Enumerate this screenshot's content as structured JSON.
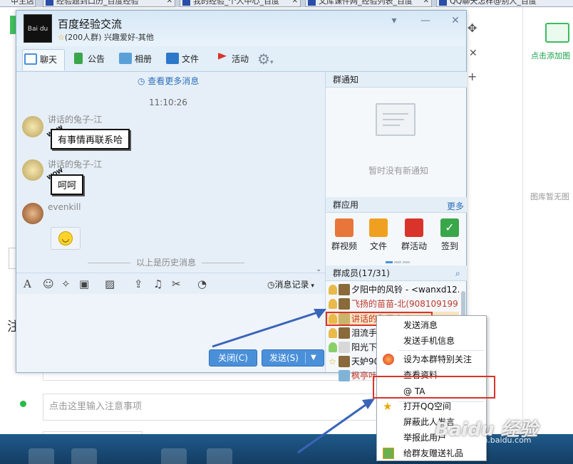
{
  "browser_tabs": [
    {
      "label": "甲主店"
    },
    {
      "label": "经验题到口历_百度经验"
    },
    {
      "label": "我的经验_个人中心_百度"
    },
    {
      "label": "文库课件网_经验列表_百度"
    },
    {
      "label": "QQ聊天怎样@别人_百度"
    }
  ],
  "background": {
    "photo_add": "点击添加图",
    "no_image": "图库暂无图",
    "note_placeholder": "点击这里输入注意事项",
    "zhu": "注"
  },
  "qq": {
    "group_logo": "Bai du 百度",
    "group_name": "百度经验交流",
    "group_meta": "(200人群) 兴趣爱好-其他",
    "window_controls": [
      "▾",
      "—",
      "✕"
    ],
    "tabs": [
      {
        "label": "聊天",
        "color": "#4a90d9"
      },
      {
        "label": "公告",
        "color": "#3aa64a"
      },
      {
        "label": "相册",
        "color": "#5aa0d8"
      },
      {
        "label": "文件",
        "color": "#2d78c8"
      },
      {
        "label": "活动",
        "color": "#d8342c"
      }
    ],
    "chat": {
      "more_messages": "查看更多消息",
      "time": "11:10:26",
      "messages": [
        {
          "sender": "讲话的兔子-江",
          "text": "有事情再联系哈"
        },
        {
          "sender": "讲话的兔子-江",
          "text": "呵呵"
        },
        {
          "sender": "evenkill",
          "text": ""
        }
      ],
      "history_divider": "以上是历史消息",
      "wow": "WOW"
    },
    "input": {
      "msg_record": "消息记录",
      "close_button": "关闭(C)",
      "send_button": "发送(S)"
    },
    "panel": {
      "notice_title": "群通知",
      "no_notice": "暂时没有新通知",
      "apps_title": "群应用",
      "apps_more": "更多",
      "apps": [
        {
          "label": "群视频",
          "color": "#e8763a"
        },
        {
          "label": "文件",
          "color": "#f0a020"
        },
        {
          "label": "群活动",
          "color": "#d8342c"
        },
        {
          "label": "签到",
          "color": "#3aa64a"
        }
      ],
      "members_title": "群成员(17/31)",
      "members": [
        {
          "name": "夕阳中的风铃 - <wanxd12...",
          "color": "#111"
        },
        {
          "name": "飞扬的苗苗-北(908109199)",
          "color": "#c0392b"
        },
        {
          "name": "讲话的兔子-江(131257???004)",
          "color": "#c0392b"
        },
        {
          "name": "泪流手",
          "color": "#111"
        },
        {
          "name": "阳光下",
          "color": "#111"
        },
        {
          "name": "天妒90",
          "color": "#111"
        },
        {
          "name": "枫亭叶",
          "color": "#c0392b"
        }
      ]
    }
  },
  "context_menu": {
    "items": [
      {
        "label": "发送消息",
        "icon": ""
      },
      {
        "label": "发送手机信息",
        "icon": ""
      },
      {
        "label": "设为本群特别关注",
        "icon": "special-follow-icon"
      },
      {
        "label": "查看资料",
        "icon": ""
      },
      {
        "label": "@ TA",
        "icon": ""
      },
      {
        "label": "打开QQ空间",
        "icon": "star-icon"
      },
      {
        "label": "屏蔽此人发言",
        "icon": ""
      },
      {
        "label": "举报此用户",
        "icon": ""
      },
      {
        "label": "给群友赠送礼品",
        "icon": "gift-icon"
      }
    ]
  },
  "watermark": {
    "main": "Baidu 经验",
    "sub": "jingyan.baidu.com"
  },
  "colors": {
    "accent": "#4a90d9",
    "highlight": "#d8342c",
    "arrow": "#3a64b8"
  }
}
